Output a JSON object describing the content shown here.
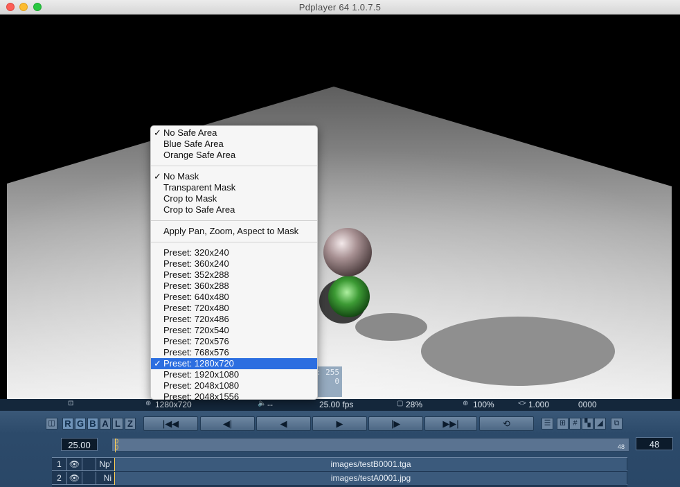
{
  "window": {
    "title": "Pdplayer 64 1.0.7.5"
  },
  "pixel_info": {
    "line1": ": 255",
    "line2": "0"
  },
  "menu": {
    "safe_area": [
      {
        "label": "No Safe Area",
        "checked": true
      },
      {
        "label": "Blue Safe Area",
        "checked": false
      },
      {
        "label": "Orange Safe Area",
        "checked": false
      }
    ],
    "mask": [
      {
        "label": "No Mask",
        "checked": true
      },
      {
        "label": "Transparent Mask",
        "checked": false
      },
      {
        "label": "Crop to Mask",
        "checked": false
      },
      {
        "label": "Crop to Safe Area",
        "checked": false
      }
    ],
    "apply": {
      "label": "Apply Pan, Zoom, Aspect to Mask"
    },
    "presets": [
      {
        "label": "Preset: 320x240",
        "checked": false
      },
      {
        "label": "Preset: 360x240",
        "checked": false
      },
      {
        "label": "Preset: 352x288",
        "checked": false
      },
      {
        "label": "Preset: 360x288",
        "checked": false
      },
      {
        "label": "Preset: 640x480",
        "checked": false
      },
      {
        "label": "Preset: 720x480",
        "checked": false
      },
      {
        "label": "Preset: 720x486",
        "checked": false
      },
      {
        "label": "Preset: 720x540",
        "checked": false
      },
      {
        "label": "Preset: 720x576",
        "checked": false
      },
      {
        "label": "Preset: 768x576",
        "checked": false
      },
      {
        "label": "Preset: 1280x720",
        "checked": true
      },
      {
        "label": "Preset: 1920x1080",
        "checked": false
      },
      {
        "label": "Preset: 2048x1080",
        "checked": false
      },
      {
        "label": "Preset: 2048x1556",
        "checked": false
      }
    ]
  },
  "status": {
    "resolution": "1280x720",
    "audio": "--",
    "fps": "25.00 fps",
    "zoom_fit": "28%",
    "zoom": "100%",
    "aspect": "1.000",
    "timecode": "0000"
  },
  "channels": [
    "R",
    "G",
    "B",
    "A",
    "L",
    "Z"
  ],
  "timeline": {
    "fps_value": "25.00",
    "start_frame": "0",
    "start_frame_sub": "0",
    "end_frame_label": "48",
    "end_frame_value": "48",
    "current_fraction": 0.0
  },
  "layers": [
    {
      "index": "1",
      "short_name": "Np'",
      "path": "images/testB0001.tga"
    },
    {
      "index": "2",
      "short_name": "Ni",
      "path": "images/testA0001.jpg"
    }
  ],
  "colors": {
    "menu_highlight": "#2c6ee0",
    "panel": "#2c4a6a",
    "status_bg": "#14273b",
    "timeline_marker": "#ffcf55"
  }
}
